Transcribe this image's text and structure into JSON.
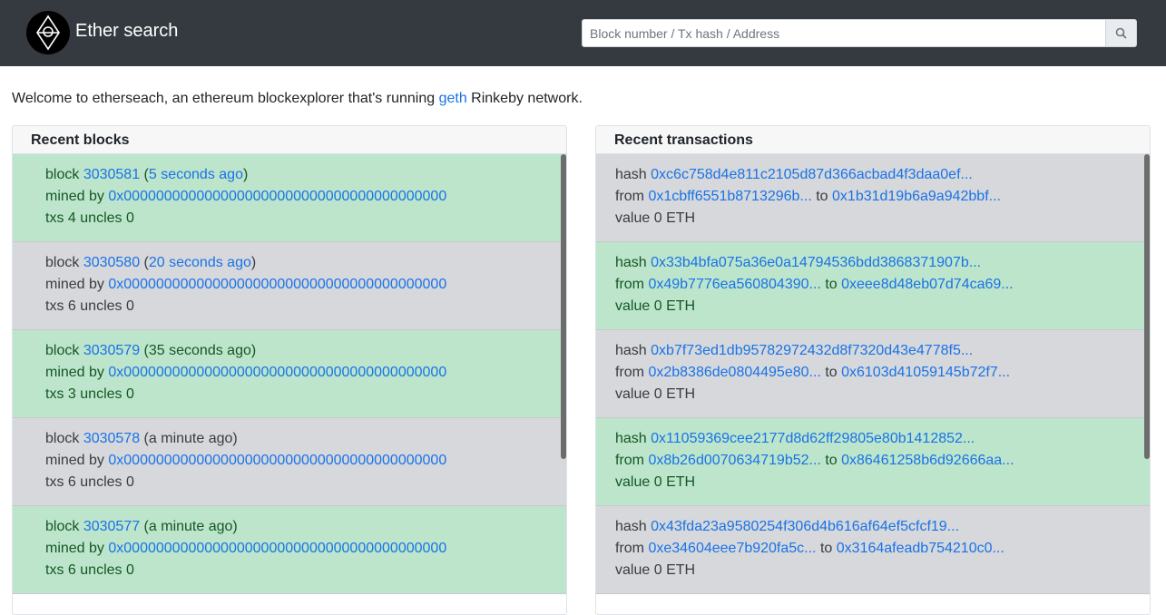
{
  "header": {
    "brand": "Ether search",
    "search_placeholder": "Block number / Tx hash / Address",
    "logo_icon": "ethereum-logo-icon",
    "search_icon": "search-icon"
  },
  "welcome": {
    "prefix": "Welcome to etherseach, an ethereum blockexplorer that's running ",
    "link": "geth",
    "suffix": " Rinkeby network."
  },
  "blocks": {
    "title": "Recent blocks",
    "items": [
      {
        "number": "3030581",
        "age": "5 seconds ago",
        "age_link": true,
        "miner": "0x0000000000000000000000000000000000000000",
        "txs": "4",
        "uncles": "0",
        "status": "green"
      },
      {
        "number": "3030580",
        "age": "20 seconds ago",
        "age_link": true,
        "miner": "0x0000000000000000000000000000000000000000",
        "txs": "6",
        "uncles": "0",
        "status": "grey"
      },
      {
        "number": "3030579",
        "age": "35 seconds ago",
        "age_link": false,
        "miner": "0x0000000000000000000000000000000000000000",
        "txs": "3",
        "uncles": "0",
        "status": "green"
      },
      {
        "number": "3030578",
        "age": "a minute ago",
        "age_link": false,
        "miner": "0x0000000000000000000000000000000000000000",
        "txs": "6",
        "uncles": "0",
        "status": "grey"
      },
      {
        "number": "3030577",
        "age": "a minute ago",
        "age_link": false,
        "miner": "0x0000000000000000000000000000000000000000",
        "txs": "6",
        "uncles": "0",
        "status": "green"
      }
    ]
  },
  "transactions": {
    "title": "Recent transactions",
    "items": [
      {
        "hash": "0xc6c758d4e811c2105d87d366acbad4f3daa0ef...",
        "from": "0x1cbff6551b8713296b...",
        "to": "0x1b31d19b6a9a942bbf...",
        "value": "0",
        "status": "grey"
      },
      {
        "hash": "0x33b4bfa075a36e0a14794536bdd3868371907b...",
        "from": "0x49b7776ea560804390...",
        "to": "0xeee8d48eb07d74ca69...",
        "value": "0",
        "status": "green"
      },
      {
        "hash": "0xb7f73ed1db95782972432d8f7320d43e4778f5...",
        "from": "0x2b8386de0804495e80...",
        "to": "0x6103d41059145b72f7...",
        "value": "0",
        "status": "grey"
      },
      {
        "hash": "0x11059369cee2177d8d62ff29805e80b1412852...",
        "from": "0x8b26d0070634719b52...",
        "to": "0x86461258b6d92666aa...",
        "value": "0",
        "status": "green"
      },
      {
        "hash": "0x43fda23a9580254f306d4b616af64ef5cfcf19...",
        "from": "0xe34604eee7b920fa5c...",
        "to": "0x3164afeadb754210c0...",
        "value": "0",
        "status": "grey"
      }
    ]
  },
  "labels": {
    "block": "block",
    "mined_by": "mined by",
    "txs": "txs",
    "uncles": "uncles",
    "hash": "hash",
    "from": "from",
    "to": "to",
    "value": "value",
    "eth": "ETH"
  }
}
